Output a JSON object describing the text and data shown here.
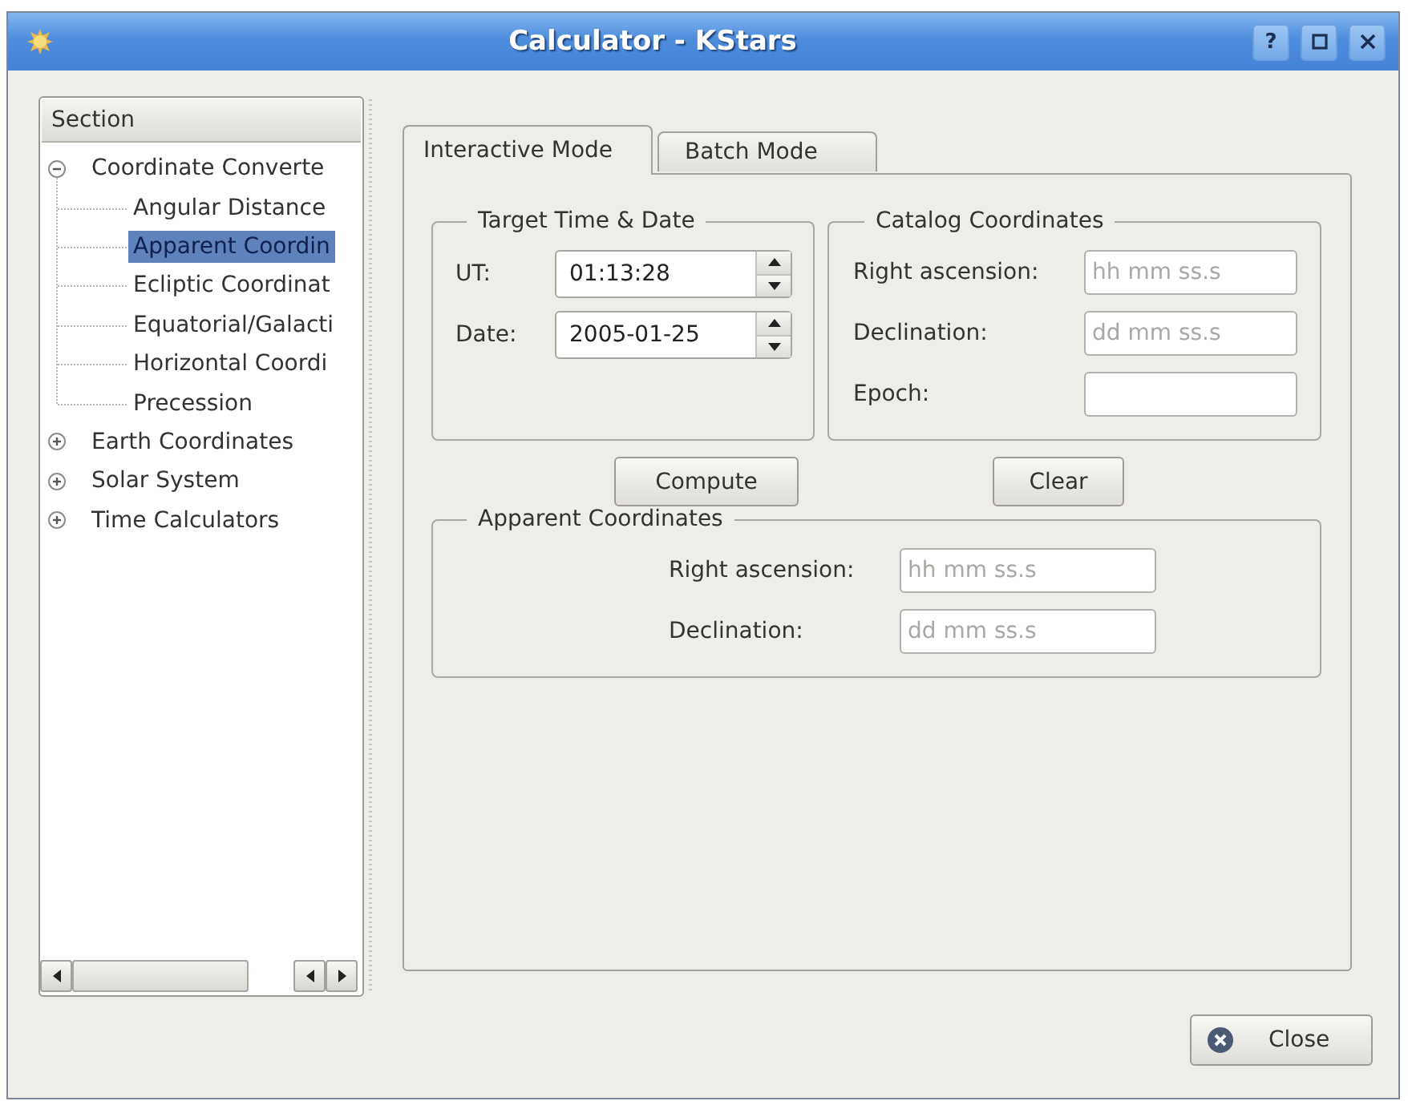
{
  "window": {
    "title": "Calculator - KStars",
    "help_button": "?"
  },
  "sidebar": {
    "header": "Section",
    "items": [
      {
        "label": "Coordinate Converte",
        "expanded": true,
        "selected": false,
        "children": [
          {
            "label": "Angular Distance",
            "selected": false
          },
          {
            "label": "Apparent Coordin",
            "selected": true
          },
          {
            "label": "Ecliptic Coordinat",
            "selected": false
          },
          {
            "label": "Equatorial/Galacti",
            "selected": false
          },
          {
            "label": "Horizontal Coordi",
            "selected": false
          },
          {
            "label": "Precession",
            "selected": false
          }
        ]
      },
      {
        "label": "Earth Coordinates",
        "expanded": false,
        "selected": false
      },
      {
        "label": "Solar System",
        "expanded": false,
        "selected": false
      },
      {
        "label": "Time Calculators",
        "expanded": false,
        "selected": false
      }
    ]
  },
  "tabs": [
    {
      "label": "Interactive Mode",
      "selected": true
    },
    {
      "label": "Batch Mode",
      "selected": false
    }
  ],
  "target_time_date": {
    "title": "Target Time & Date",
    "fields": [
      {
        "label": "UT:",
        "value": "01:13:28"
      },
      {
        "label": "Date:",
        "value": "2005-01-25"
      }
    ]
  },
  "catalog_coordinates": {
    "title": "Catalog Coordinates",
    "fields": [
      {
        "label": "Right ascension:",
        "placeholder": "hh mm ss.s"
      },
      {
        "label": "Declination:",
        "placeholder": "dd mm ss.s"
      },
      {
        "label": "Epoch:"
      }
    ]
  },
  "compute_button": "Compute",
  "clear_button": "Clear",
  "apparent_coordinates": {
    "title": "Apparent Coordinates",
    "fields": [
      {
        "label": "Right ascension:",
        "placeholder": "hh mm ss.s"
      },
      {
        "label": "Declination:",
        "placeholder": "dd mm ss.s"
      }
    ]
  },
  "close_button": "Close"
}
